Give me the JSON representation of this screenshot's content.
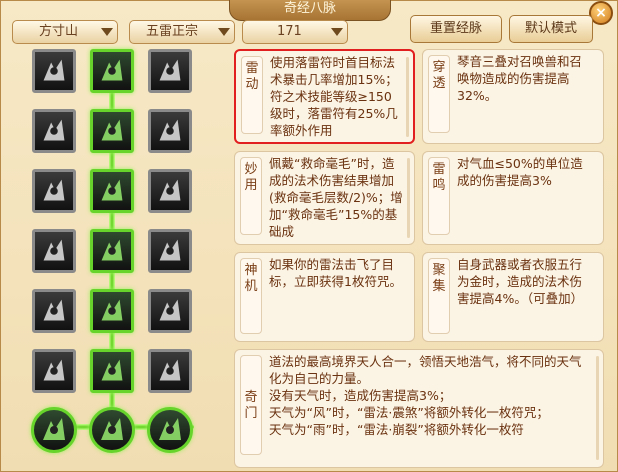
{
  "window": {
    "title": "奇经八脉",
    "close": "×"
  },
  "filters": {
    "school": "方寸山",
    "branch": "五雷正宗",
    "level": "171"
  },
  "buttons": {
    "reset": "重置经脉",
    "default": "默认模式"
  },
  "skills": {
    "left": [
      "shock-icon",
      "rain-icon",
      "fire-icon",
      "lightning-icon",
      "spikes-icon",
      "cards-icon",
      "swirl-icon"
    ],
    "center": [
      "talisman-icon",
      "rune-icon",
      "wave-icon",
      "arrow-down-icon",
      "stream-icon",
      "scrolls-icon",
      "mask-icon"
    ],
    "right": [
      "storm-icon",
      "staff-icon",
      "feather-icon",
      "yinyang-icon",
      "orb-icon",
      "tablet-icon",
      "swirl-icon"
    ]
  },
  "cards": [
    {
      "label": "雷动",
      "text": "使用落雷符时首目标法术暴击几率增加15%；符之术技能等级≥150级时，落雷符有25%几率额外作用"
    },
    {
      "label": "穿透",
      "text": "琴音三叠对召唤兽和召唤物造成的伤害提高32%。"
    },
    {
      "label": "妙用",
      "text": "佩戴“救命毫毛”时，造成的法术伤害结果增加(救命毫毛层数/2)%；增加“救命毫毛”15%的基础成"
    },
    {
      "label": "雷鸣",
      "text": "对气血≤50%的单位造成的伤害提高3%"
    },
    {
      "label": "神机",
      "text": "如果你的雷法击飞了目标，立即获得1枚符咒。"
    },
    {
      "label": "聚集",
      "text": "自身武器或者衣服五行为金时，造成的法术伤害提高4%。（可叠加）"
    },
    {
      "label": "奇门",
      "text": "道法的最高境界天人合一，领悟天地浩气，将不同的天气化为自己的力量。\n没有天气时，造成伤害提高3%；\n天气为“风”时，“雷法·震煞”将额外转化一枚符咒；\n天气为“雨”时，“雷法·崩裂”将额外转化一枚符"
    }
  ]
}
